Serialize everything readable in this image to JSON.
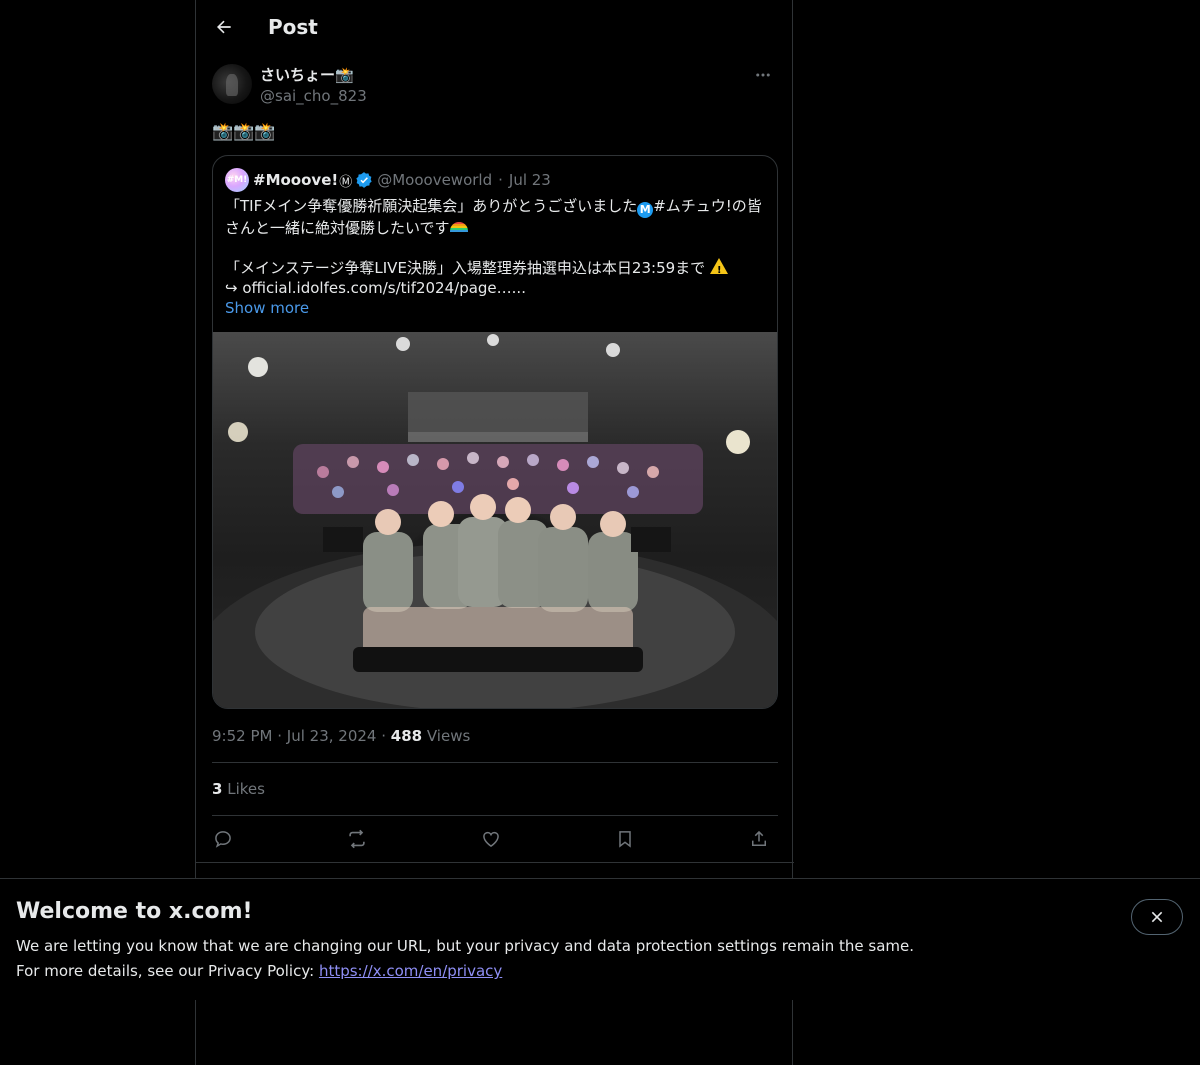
{
  "header": {
    "title": "Post"
  },
  "post": {
    "author": {
      "display_name": "さいちょー📸",
      "handle": "@sai_cho_823"
    },
    "text": "📸📸📸",
    "quote": {
      "name": "#Mooove!",
      "name_badge": "Ⓜ",
      "handle": "@Moooveworld",
      "date": "Jul 23",
      "line1a": "「TIFメイン争奪優勝祈願決起集会」ありがとうございました",
      "line1b": "#ムチュウ!の皆",
      "line2": "さんと一緒に絶対優勝したいです",
      "line3": "「メインステージ争奪LIVE決勝」入場整理券抽選申込は本日23:59まで",
      "line4": "↪ official.idolfes.com/s/tif2024/page…...",
      "show_more": "Show more",
      "avatar_text": "#M!"
    },
    "time": "9:52 PM",
    "date": "Jul 23, 2024",
    "views_count": "488",
    "views_label": "Views",
    "likes_count": "3",
    "likes_label": "Likes"
  },
  "banner": {
    "title": "Welcome to x.com!",
    "line1": "We are letting you know that we are changing our URL, but your privacy and data protection settings remain the same.",
    "line2_prefix": "For more details, see our Privacy Policy: ",
    "link": "https://x.com/en/privacy"
  },
  "colors": {
    "accent": "#1d9bf0",
    "link": "#4a99e9",
    "muted": "#71767b",
    "border": "#2f3336"
  }
}
